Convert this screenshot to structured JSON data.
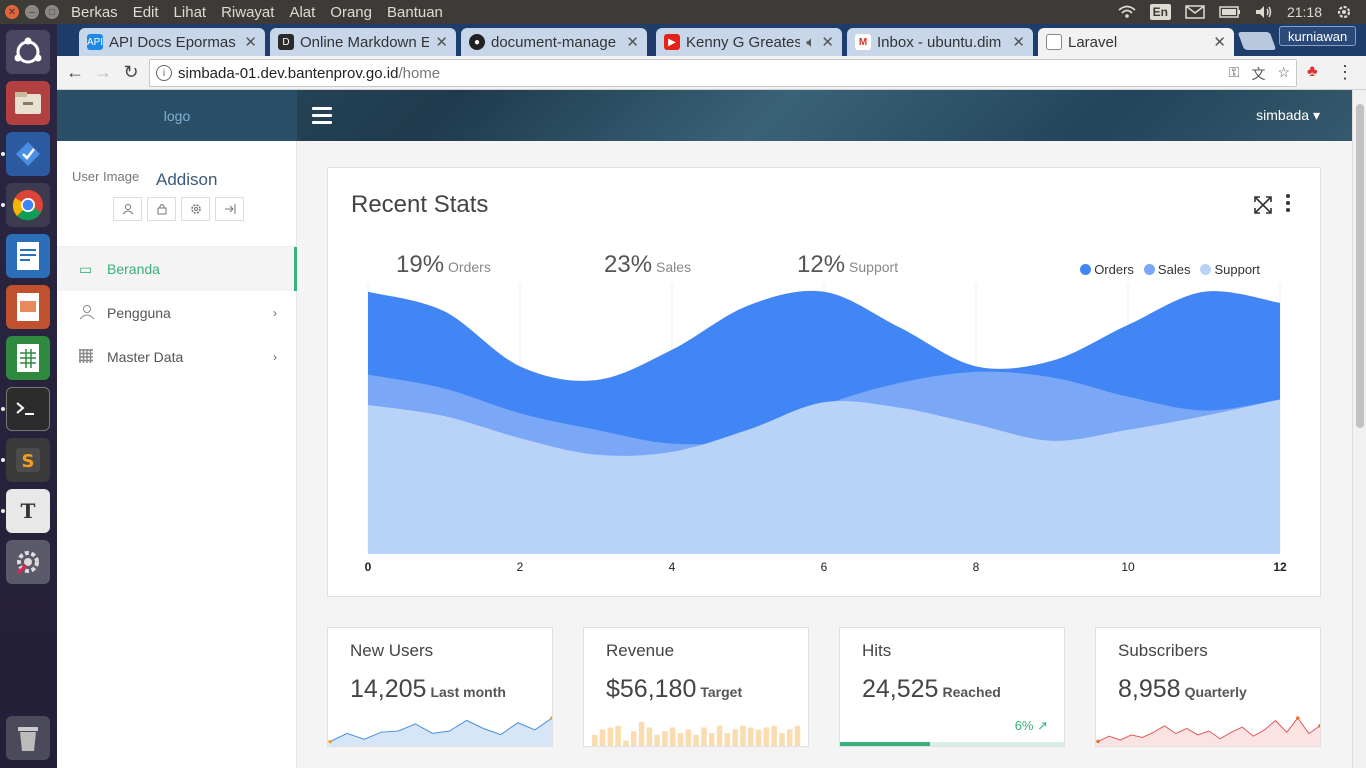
{
  "system": {
    "menus": [
      "Berkas",
      "Edit",
      "Lihat",
      "Riwayat",
      "Alat",
      "Orang",
      "Bantuan"
    ],
    "lang": "En",
    "clock": "21:18"
  },
  "browser": {
    "tabs": [
      {
        "label": "API Docs Epormas",
        "favicon": "api-icon"
      },
      {
        "label": "Online Markdown E",
        "favicon": "d-icon"
      },
      {
        "label": "document-manage",
        "favicon": "github-icon"
      },
      {
        "label": "Kenny G Greatest",
        "favicon": "youtube-icon"
      },
      {
        "label": "Inbox - ubuntu.dim",
        "favicon": "gmail-icon"
      },
      {
        "label": "Laravel",
        "favicon": "page-icon"
      }
    ],
    "profile": "kurniawan",
    "url_host": "simbada-01.dev.bantenprov.go.id",
    "url_path": "/home"
  },
  "app": {
    "logo": "logo",
    "user_menu": "simbada ▾",
    "user_image": "User Image",
    "user_name": "Addison",
    "menu": [
      {
        "label": "Beranda",
        "icon": "video-icon"
      },
      {
        "label": "Pengguna",
        "icon": "user-icon"
      },
      {
        "label": "Master Data",
        "icon": "grid-icon"
      }
    ]
  },
  "recent_stats": {
    "title": "Recent Stats",
    "stats": [
      {
        "value": "19%",
        "label": "Orders"
      },
      {
        "value": "23%",
        "label": "Sales"
      },
      {
        "value": "12%",
        "label": "Support"
      }
    ]
  },
  "chart_data": {
    "type": "area",
    "x": [
      0,
      1,
      2,
      3,
      4,
      5,
      6,
      7,
      8,
      9,
      10,
      11,
      12
    ],
    "xticks": [
      "0",
      "2",
      "4",
      "6",
      "8",
      "10",
      "12"
    ],
    "series": [
      {
        "name": "Orders",
        "color": "#4285f4",
        "values": [
          95,
          88,
          68,
          63,
          74,
          90,
          95,
          82,
          68,
          70,
          83,
          95,
          91
        ]
      },
      {
        "name": "Sales",
        "color": "#7ba7f7",
        "values": [
          65,
          60,
          51,
          45,
          40,
          42,
          54,
          62,
          66,
          64,
          57,
          52,
          56
        ]
      },
      {
        "name": "Support",
        "color": "#b8d2f8",
        "values": [
          54,
          50,
          42,
          36,
          37,
          45,
          55,
          53,
          47,
          41,
          45,
          50,
          56
        ]
      }
    ],
    "ylim": [
      0,
      100
    ],
    "legend": "top-right"
  },
  "cards": [
    {
      "title": "New Users",
      "value": "14,205",
      "sub": "Last month",
      "spark": "line-blue",
      "data": [
        2,
        9,
        4,
        10,
        11,
        17,
        9,
        11,
        20,
        13,
        8,
        18,
        12,
        22
      ]
    },
    {
      "title": "Revenue",
      "value": "$56,180",
      "sub": "Target",
      "spark": "bars-orange",
      "data": [
        6,
        9,
        10,
        11,
        3,
        8,
        13,
        10,
        6,
        8,
        10,
        7,
        9,
        6,
        10,
        7,
        11,
        7,
        9,
        11,
        10,
        9,
        10,
        11,
        7,
        9,
        11
      ]
    },
    {
      "title": "Hits",
      "value": "24,525",
      "sub": "Reached",
      "percent": "6% ↗",
      "progress": 0.4
    },
    {
      "title": "Subscribers",
      "value": "8,958",
      "sub": "Quarterly",
      "spark": "line-red",
      "data": [
        2,
        6,
        3,
        7,
        5,
        9,
        14,
        8,
        12,
        7,
        10,
        4,
        9,
        13,
        6,
        11,
        18,
        9,
        20,
        8,
        14
      ]
    }
  ]
}
